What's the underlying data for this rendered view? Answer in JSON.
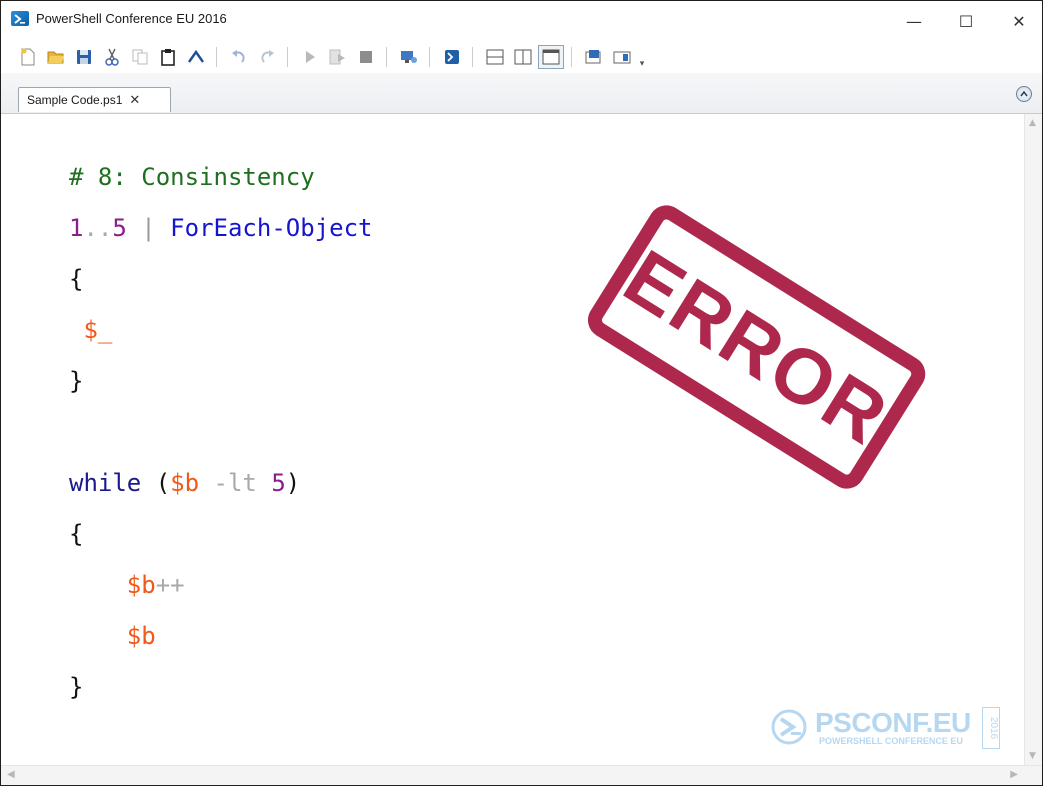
{
  "window": {
    "title": "PowerShell Conference EU 2016",
    "controls": {
      "minimize": "—",
      "maximize": "☐",
      "close": "✕"
    }
  },
  "toolbar": {
    "icons": [
      "new-icon",
      "open-icon",
      "save-icon",
      "cut-icon",
      "copy-icon",
      "paste-icon",
      "powershell-prompt-icon",
      "undo-icon",
      "redo-icon",
      "run-icon",
      "run-selection-icon",
      "stop-icon",
      "remote-powershell-icon",
      "powershell-console-icon",
      "layout-top-icon",
      "layout-right-icon",
      "layout-max-icon",
      "show-script-pane-icon",
      "show-commands-icon"
    ]
  },
  "tabs": [
    {
      "label": "Sample Code.ps1",
      "close": "✕"
    }
  ],
  "code": {
    "lines": [
      [
        {
          "t": "# 8: Consinstency",
          "k": "comment"
        }
      ],
      [
        {
          "t": "1",
          "k": "number"
        },
        {
          "t": "..",
          "k": "op"
        },
        {
          "t": "5",
          "k": "number"
        },
        {
          "t": " | ",
          "k": "pipe"
        },
        {
          "t": "ForEach-Object",
          "k": "cmdlet"
        }
      ],
      [
        {
          "t": "{",
          "k": "plain"
        }
      ],
      [
        {
          "t": " $_",
          "k": "var"
        }
      ],
      [
        {
          "t": "}",
          "k": "plain"
        }
      ],
      [],
      [
        {
          "t": "while",
          "k": "keyword"
        },
        {
          "t": " (",
          "k": "plain"
        },
        {
          "t": "$b",
          "k": "var"
        },
        {
          "t": " -lt ",
          "k": "op"
        },
        {
          "t": "5",
          "k": "number"
        },
        {
          "t": ")",
          "k": "plain"
        }
      ],
      [
        {
          "t": "{",
          "k": "plain"
        }
      ],
      [
        {
          "t": "    ",
          "k": "plain"
        },
        {
          "t": "$b",
          "k": "var"
        },
        {
          "t": "++",
          "k": "op"
        }
      ],
      [
        {
          "t": "    ",
          "k": "plain"
        },
        {
          "t": "$b",
          "k": "var"
        }
      ],
      [
        {
          "t": "}",
          "k": "plain"
        }
      ]
    ]
  },
  "stamp": {
    "text": "ERROR",
    "color": "#a8163e"
  },
  "logo": {
    "main": "PSCONF.EU",
    "sub": "POWERSHELL CONFERENCE EU",
    "year": "2016"
  }
}
